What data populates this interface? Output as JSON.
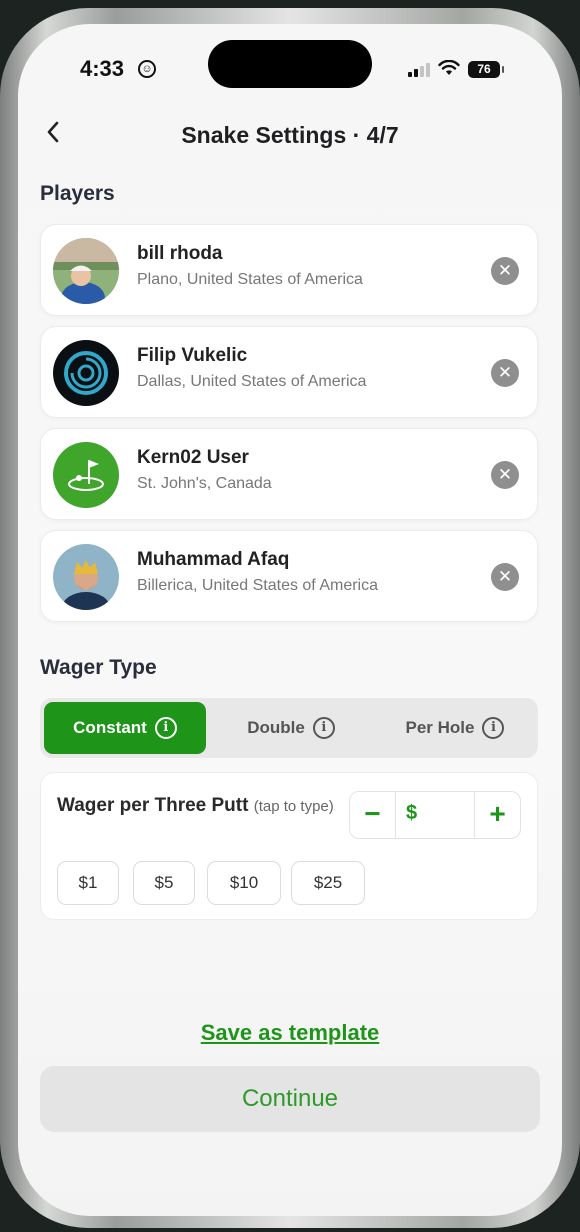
{
  "status_bar": {
    "time": "4:33",
    "battery": "76"
  },
  "header": {
    "title": "Snake Settings · 4/7",
    "back_icon": "chevron-left-icon"
  },
  "players_section": {
    "title": "Players",
    "players": [
      {
        "name": "bill rhoda",
        "location": "Plano, United States of America",
        "avatar": "photo-golfer"
      },
      {
        "name": "Filip Vukelic",
        "location": "Dallas, United States of America",
        "avatar": "logo-ring"
      },
      {
        "name": "Kern02 User",
        "location": "St. John's, Canada",
        "avatar": "logo-golf-green"
      },
      {
        "name": "Muhammad Afaq",
        "location": "Billerica, United States of America",
        "avatar": "photo-person"
      }
    ]
  },
  "wager_type": {
    "title": "Wager Type",
    "options": [
      {
        "label": "Constant",
        "active": true
      },
      {
        "label": "Double",
        "active": false
      },
      {
        "label": "Per Hole",
        "active": false
      }
    ]
  },
  "wager": {
    "label": "Wager per Three Putt",
    "hint": "(tap to type)",
    "minus": "−",
    "plus": "+",
    "currency": "$",
    "presets": [
      "$1",
      "$5",
      "$10",
      "$25"
    ]
  },
  "footer": {
    "save_template": "Save as template",
    "continue": "Continue"
  },
  "colors": {
    "accent": "#1e9419",
    "background": "#f7f7f7",
    "remove": "#8f8f8f"
  }
}
